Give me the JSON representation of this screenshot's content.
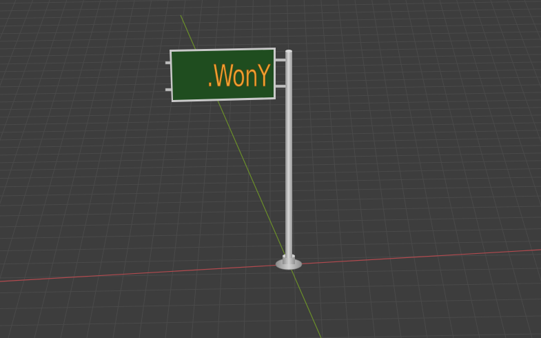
{
  "viewport": {
    "background_color": "#3d3d3d",
    "grid_color": "#4a4a4a",
    "x_axis_color": "#b24a4f",
    "y_axis_color": "#6b8f2a"
  },
  "sign": {
    "text": ".WonY",
    "board_color": "#1f4d1f",
    "frame_color": "#c9c9c9",
    "text_color": "#f0a030"
  },
  "pole": {
    "color": "#bdbdbd"
  }
}
